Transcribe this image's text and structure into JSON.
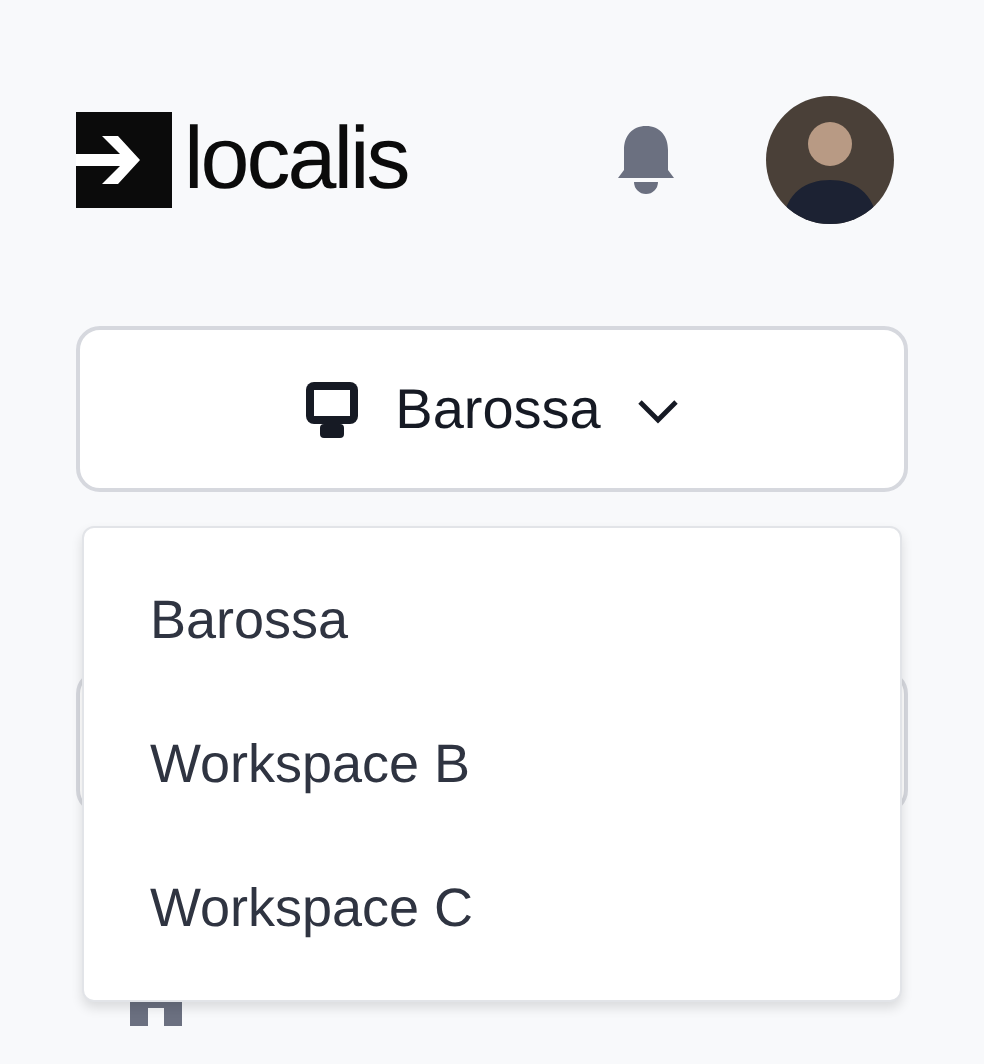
{
  "header": {
    "logo_text": "localis"
  },
  "workspace_select": {
    "value": "Barossa",
    "expanded": true
  },
  "workspace_menu": [
    {
      "label": "Barossa",
      "selected": false
    },
    {
      "label": "Workspace B",
      "selected": false
    },
    {
      "label": "Workspace C",
      "selected": false
    }
  ]
}
